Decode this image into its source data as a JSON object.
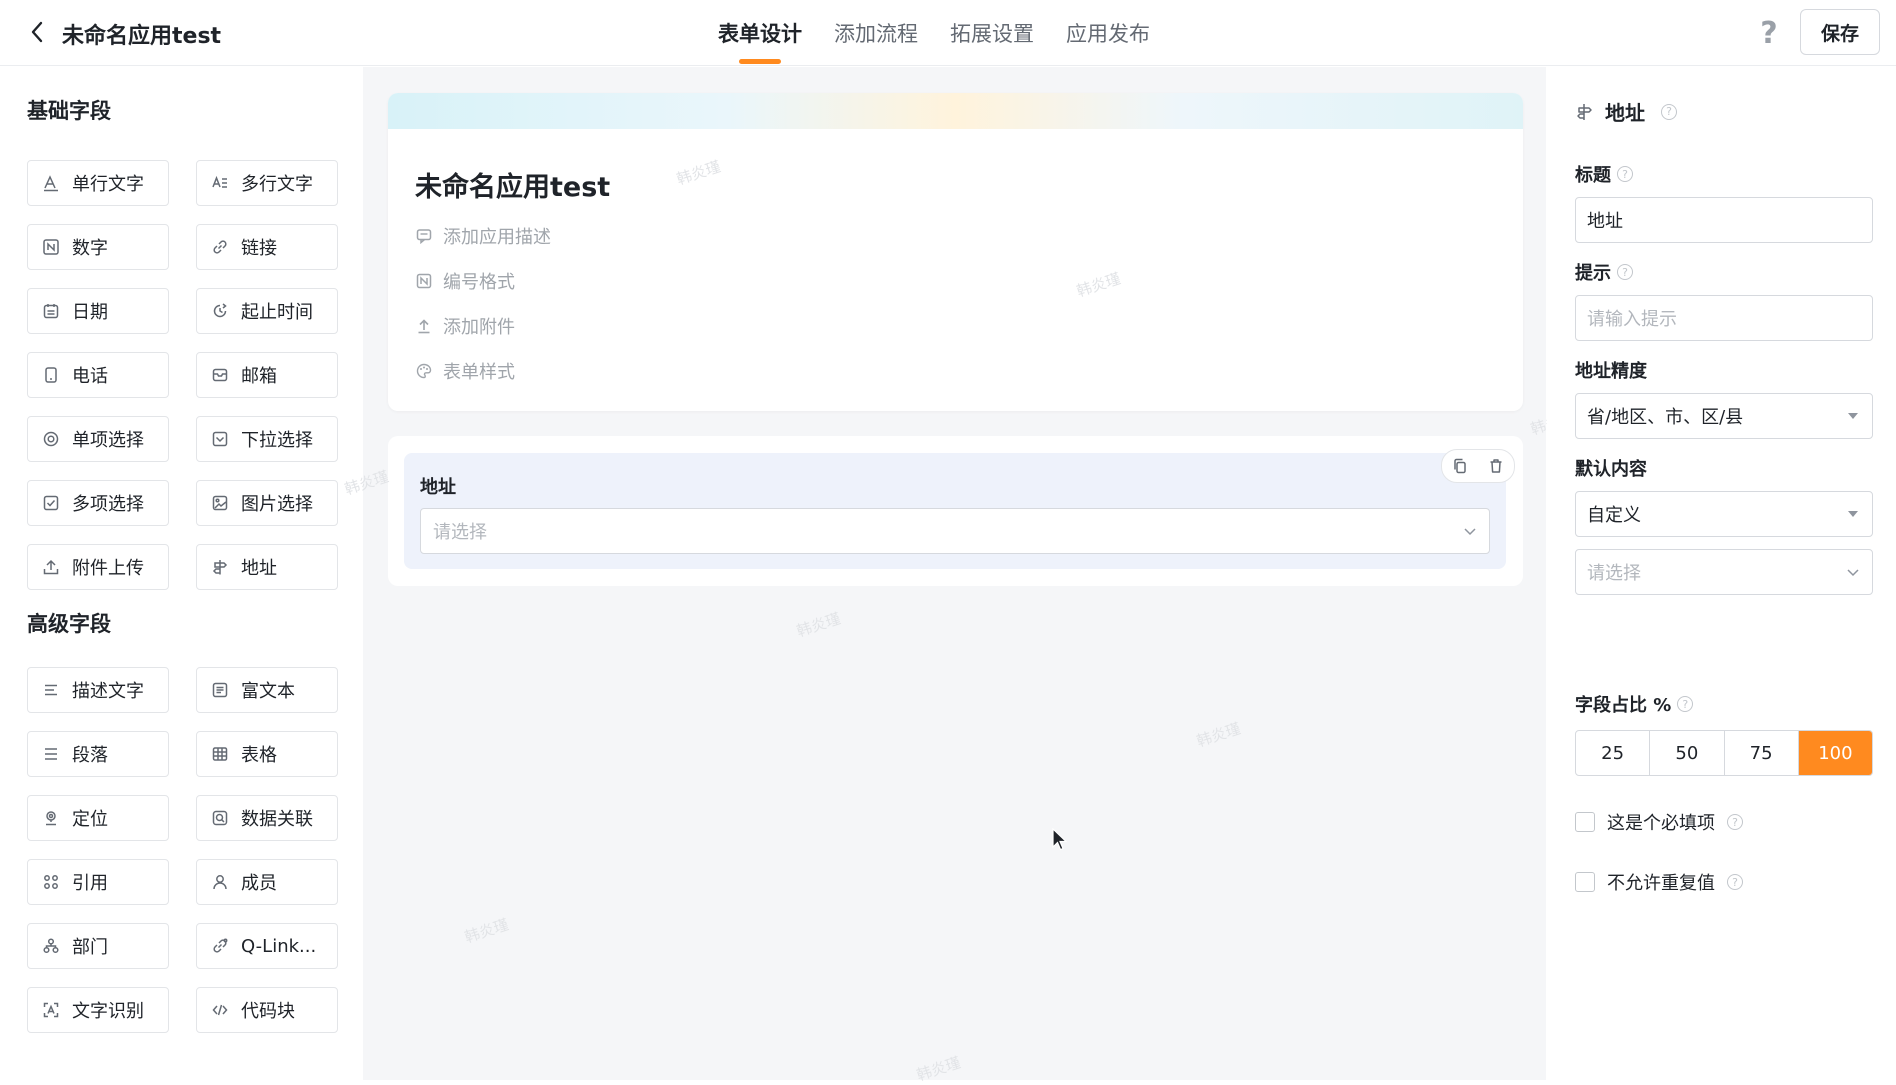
{
  "header": {
    "app_title": "未命名应用test",
    "tabs": [
      {
        "label": "表单设计",
        "active": true
      },
      {
        "label": "添加流程",
        "active": false
      },
      {
        "label": "拓展设置",
        "active": false
      },
      {
        "label": "应用发布",
        "active": false
      }
    ],
    "help": "?",
    "save_label": "保存",
    "accent_color": "#ff8a1f"
  },
  "left_panel": {
    "basic_title": "基础字段",
    "basic_fields": [
      {
        "label": "单行文字",
        "icon": "single-line-text-icon"
      },
      {
        "label": "多行文字",
        "icon": "multi-line-text-icon"
      },
      {
        "label": "数字",
        "icon": "number-icon"
      },
      {
        "label": "链接",
        "icon": "link-icon"
      },
      {
        "label": "日期",
        "icon": "calendar-icon"
      },
      {
        "label": "起止时间",
        "icon": "time-range-icon"
      },
      {
        "label": "电话",
        "icon": "phone-icon"
      },
      {
        "label": "邮箱",
        "icon": "mail-icon"
      },
      {
        "label": "单项选择",
        "icon": "radio-icon"
      },
      {
        "label": "下拉选择",
        "icon": "dropdown-icon"
      },
      {
        "label": "多项选择",
        "icon": "checkbox-icon"
      },
      {
        "label": "图片选择",
        "icon": "image-icon"
      },
      {
        "label": "附件上传",
        "icon": "upload-icon"
      },
      {
        "label": "地址",
        "icon": "signpost-icon"
      }
    ],
    "advanced_title": "高级字段",
    "advanced_fields": [
      {
        "label": "描述文字",
        "icon": "description-icon"
      },
      {
        "label": "富文本",
        "icon": "rich-text-icon"
      },
      {
        "label": "段落",
        "icon": "paragraph-icon"
      },
      {
        "label": "表格",
        "icon": "table-icon"
      },
      {
        "label": "定位",
        "icon": "location-icon"
      },
      {
        "label": "数据关联",
        "icon": "data-link-icon"
      },
      {
        "label": "引用",
        "icon": "reference-icon"
      },
      {
        "label": "成员",
        "icon": "member-icon"
      },
      {
        "label": "部门",
        "icon": "department-icon"
      },
      {
        "label": "Q-Link...",
        "icon": "q-link-icon"
      },
      {
        "label": "文字识别",
        "icon": "ocr-icon"
      },
      {
        "label": "代码块",
        "icon": "code-icon"
      }
    ]
  },
  "canvas": {
    "form_title": "未命名应用test",
    "meta_items": [
      {
        "label": "添加应用描述",
        "icon": "comment-icon"
      },
      {
        "label": "编号格式",
        "icon": "number-format-icon"
      },
      {
        "label": "添加附件",
        "icon": "attachment-icon"
      },
      {
        "label": "表单样式",
        "icon": "palette-icon"
      }
    ],
    "field": {
      "label": "地址",
      "placeholder": "请选择"
    },
    "watermark": "韩炎瑾"
  },
  "right_panel": {
    "title": "地址",
    "label_title": "标题",
    "title_value": "地址",
    "label_hint": "提示",
    "hint_placeholder": "请输入提示",
    "label_precision": "地址精度",
    "precision_value": "省/地区、市、区/县",
    "label_default": "默认内容",
    "default_mode": "自定义",
    "default_placeholder": "请选择",
    "label_ratio": "字段占比 %",
    "ratio_options": [
      "25",
      "50",
      "75",
      "100"
    ],
    "ratio_selected": "100",
    "required_label": "这是个必填项",
    "no_duplicate_label": "不允许重复值"
  }
}
